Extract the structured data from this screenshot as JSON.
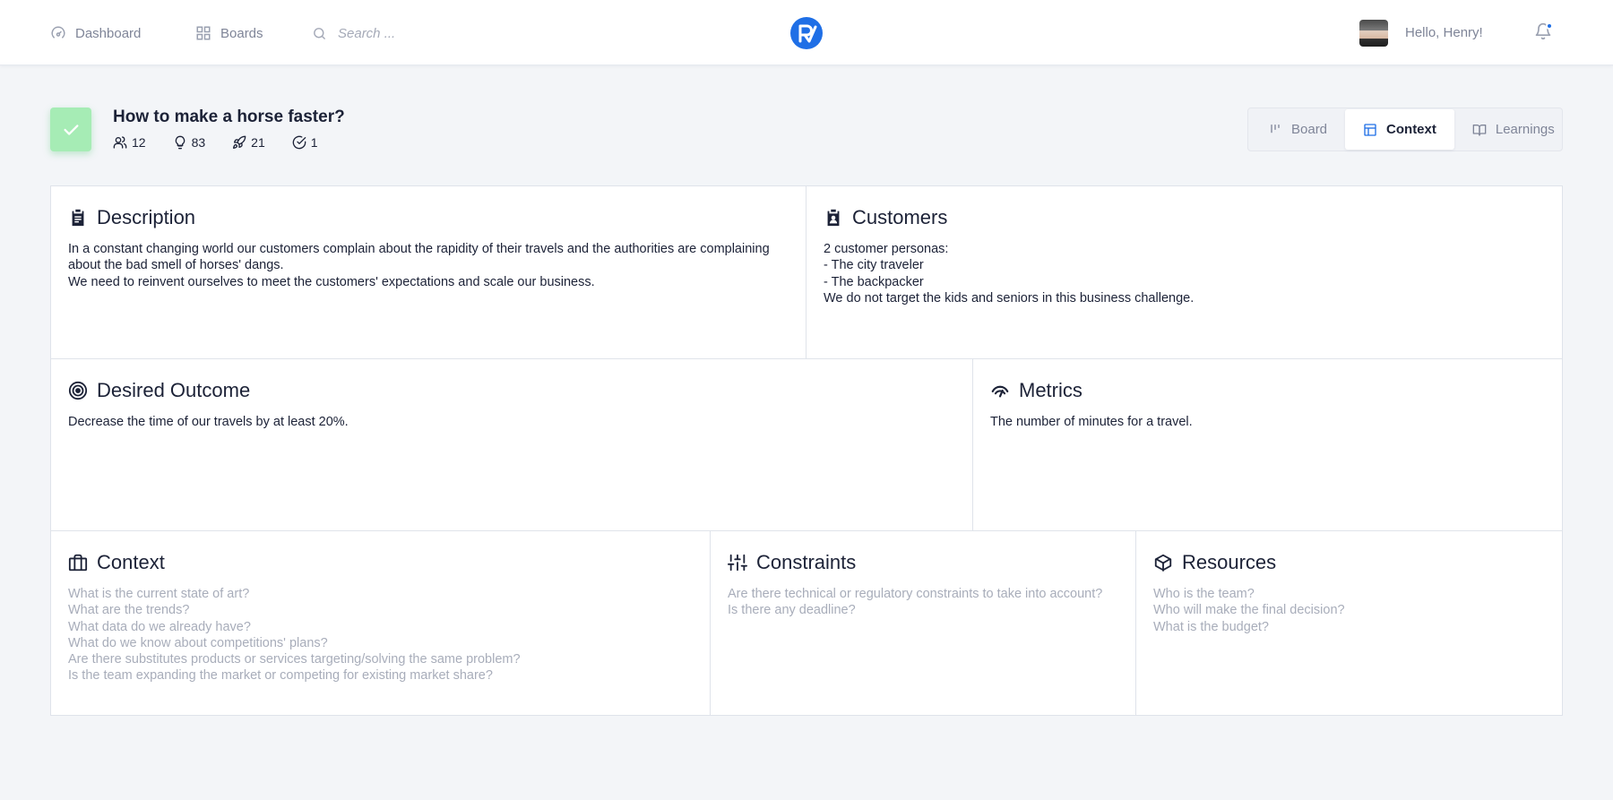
{
  "nav": {
    "dashboard_label": "Dashboard",
    "boards_label": "Boards",
    "search_placeholder": "Search ...",
    "greeting": "Hello, Henry!",
    "accent_color": "#1f6fe6"
  },
  "board": {
    "title": "How to make a horse faster?",
    "tile_color": "#a6ecb5",
    "stats": {
      "members": "12",
      "ideas": "83",
      "launched": "21",
      "done": "1"
    }
  },
  "view_tabs": [
    {
      "label": "Board",
      "icon": "board-icon",
      "active": false
    },
    {
      "label": "Context",
      "icon": "layout-icon",
      "active": true
    },
    {
      "label": "Learnings",
      "icon": "book-icon",
      "active": false
    }
  ],
  "sections": {
    "description": {
      "title": "Description",
      "icon": "clipboard-icon",
      "lines": [
        "In a constant changing world our customers complain about the rapidity of their travels and the authorities are complaining about the bad smell of horses' dangs.",
        "We need to reinvent ourselves to meet the customers' expectations and scale our business."
      ]
    },
    "customers": {
      "title": "Customers",
      "icon": "contact-clipboard-icon",
      "lines": [
        "2 customer personas:",
        "- The city traveler",
        "- The backpacker",
        "We do not target the kids and seniors in this business challenge."
      ]
    },
    "desired_outcome": {
      "title": "Desired Outcome",
      "icon": "target-icon",
      "lines": [
        "Decrease the time of our travels by at least 20%."
      ]
    },
    "metrics": {
      "title": "Metrics",
      "icon": "gauge-icon",
      "lines": [
        "The number of minutes for a travel."
      ]
    },
    "context": {
      "title": "Context",
      "icon": "briefcase-icon",
      "lines": [
        "What is the current state of art?",
        "What are the trends?",
        "What data do we already have?",
        "What do we know about competitions' plans?",
        "Are there substitutes products or services targeting/solving the same problem?",
        "Is the team expanding the market or competing for existing market share?"
      ]
    },
    "constraints": {
      "title": "Constraints",
      "icon": "sliders-icon",
      "lines": [
        "Are there technical or regulatory constraints to take into account?",
        "Is there any deadline?"
      ]
    },
    "resources": {
      "title": "Resources",
      "icon": "cube-icon",
      "lines": [
        "Who is the team?",
        "Who will make the final decision?",
        "What is the budget?"
      ]
    }
  }
}
